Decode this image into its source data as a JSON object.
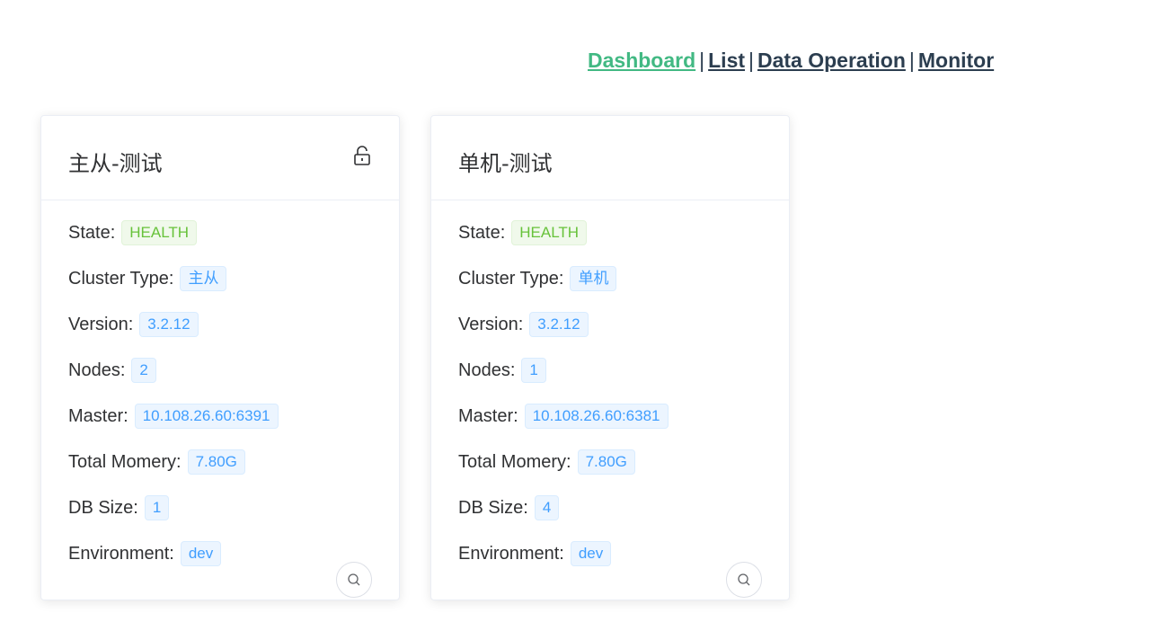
{
  "nav": {
    "items": [
      {
        "label": "Dashboard"
      },
      {
        "label": "List"
      },
      {
        "label": "Data Operation"
      },
      {
        "label": "Monitor"
      }
    ],
    "separator": "|"
  },
  "clusters": [
    {
      "name": "主从-测试",
      "locked": true,
      "fields": [
        {
          "label": "State:",
          "value": "HEALTH",
          "status": "success"
        },
        {
          "label": "Cluster Type:",
          "value": "主从"
        },
        {
          "label": "Version:",
          "value": "3.2.12"
        },
        {
          "label": "Nodes:",
          "value": "2"
        },
        {
          "label": "Master:",
          "value": "10.108.26.60:6391"
        },
        {
          "label": "Total Momery:",
          "value": "7.80G"
        },
        {
          "label": "DB Size:",
          "value": "1"
        },
        {
          "label": "Environment:",
          "value": "dev"
        }
      ]
    },
    {
      "name": "单机-测试",
      "locked": false,
      "fields": [
        {
          "label": "State:",
          "value": "HEALTH",
          "status": "success"
        },
        {
          "label": "Cluster Type:",
          "value": "单机"
        },
        {
          "label": "Version:",
          "value": "3.2.12"
        },
        {
          "label": "Nodes:",
          "value": "1"
        },
        {
          "label": "Master:",
          "value": "10.108.26.60:6381"
        },
        {
          "label": "Total Momery:",
          "value": "7.80G"
        },
        {
          "label": "DB Size:",
          "value": "4"
        },
        {
          "label": "Environment:",
          "value": "dev"
        }
      ]
    }
  ],
  "icons": {
    "lock": "lock-icon",
    "search": "search-icon"
  },
  "colors": {
    "nav_active": "#42b983",
    "nav_default": "#2c3e50",
    "tag_primary": "#409eff",
    "tag_success": "#67c23a"
  }
}
